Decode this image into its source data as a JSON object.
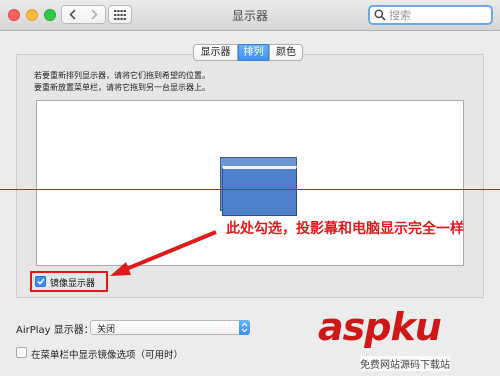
{
  "window": {
    "title": "显示器"
  },
  "search": {
    "placeholder": "搜索"
  },
  "tabs": [
    {
      "label": "显示器",
      "selected": false
    },
    {
      "label": "排列",
      "selected": true
    },
    {
      "label": "颜色",
      "selected": false
    }
  ],
  "arrangement": {
    "instruction_line1": "若要重新排列显示器，请将它们拖到希望的位置。",
    "instruction_line2": "要重新放置菜单栏，请将它拖到另一台显示器上。"
  },
  "mirror": {
    "label": "镜像显示器",
    "checked": true
  },
  "annotation": {
    "text": "此处勾选，投影幕和电脑显示完全一样",
    "color": "#e01a1a"
  },
  "airplay": {
    "label": "AirPlay 显示器：",
    "value": "关闭"
  },
  "menubar_option": {
    "label": "在菜单栏中显示镜像选项（可用时）",
    "checked": false
  },
  "watermark": {
    "text": "aspku",
    "sub": "免费网站源码下载站"
  },
  "colors": {
    "accent": "#3e8ff5",
    "annotation_red": "#e01a1a",
    "display_blue": "#4f80cc"
  },
  "icons": [
    "back-icon",
    "forward-icon",
    "grid-icon",
    "search-icon",
    "checkmark-icon",
    "select-arrows-icon"
  ]
}
